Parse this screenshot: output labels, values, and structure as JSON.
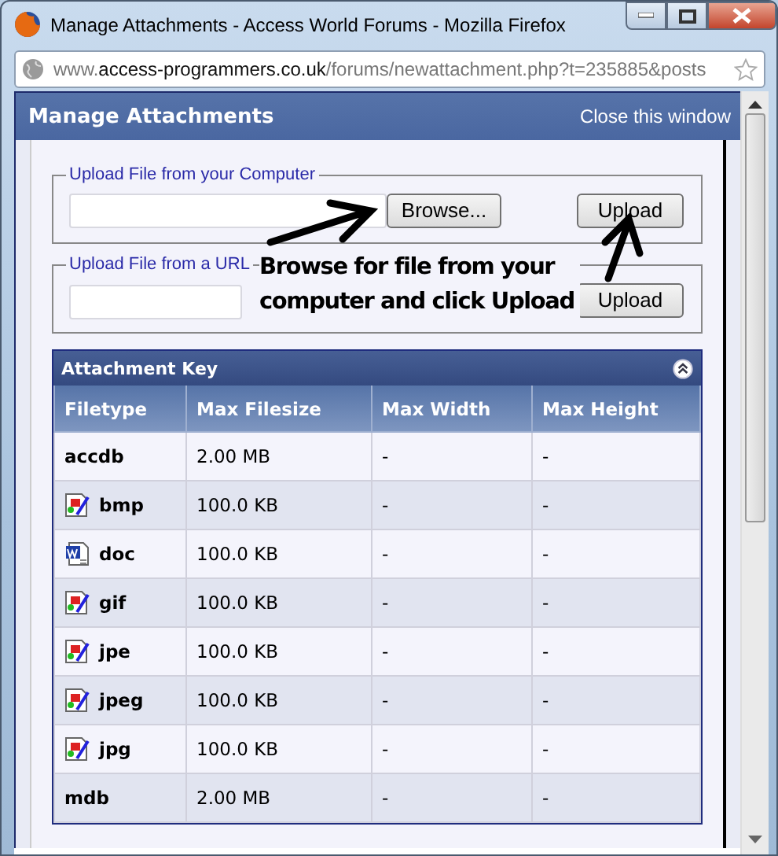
{
  "window": {
    "title": "Manage Attachments - Access World Forums - Mozilla Firefox"
  },
  "address_bar": {
    "url_prefix": "www.",
    "url_domain": "access-programmers.co.uk",
    "url_path": "/forums/newattachment.php?t=235885&posts"
  },
  "dialog": {
    "title": "Manage Attachments",
    "close_link": "Close this window"
  },
  "upload_sections": [
    {
      "kind": "file",
      "legend": "Upload File from your Computer",
      "browse_button": "Browse...",
      "upload_button": "Upload"
    },
    {
      "kind": "url",
      "legend": "Upload File from a URL",
      "upload_button": "Upload"
    }
  ],
  "annotation": {
    "text": "Browse for file from your computer and click Upload"
  },
  "attachment_key": {
    "title": "Attachment Key",
    "columns": [
      "Filetype",
      "Max Filesize",
      "Max Width",
      "Max Height"
    ],
    "rows": [
      {
        "kind": "plain",
        "filetype": "accdb",
        "max_filesize": "2.00 MB",
        "max_width": "-",
        "max_height": "-"
      },
      {
        "kind": "image",
        "filetype": "bmp",
        "max_filesize": "100.0 KB",
        "max_width": "-",
        "max_height": "-"
      },
      {
        "kind": "document",
        "filetype": "doc",
        "max_filesize": "100.0 KB",
        "max_width": "-",
        "max_height": "-"
      },
      {
        "kind": "image",
        "filetype": "gif",
        "max_filesize": "100.0 KB",
        "max_width": "-",
        "max_height": "-"
      },
      {
        "kind": "image",
        "filetype": "jpe",
        "max_filesize": "100.0 KB",
        "max_width": "-",
        "max_height": "-"
      },
      {
        "kind": "image",
        "filetype": "jpeg",
        "max_filesize": "100.0 KB",
        "max_width": "-",
        "max_height": "-"
      },
      {
        "kind": "image",
        "filetype": "jpg",
        "max_filesize": "100.0 KB",
        "max_width": "-",
        "max_height": "-"
      },
      {
        "kind": "plain",
        "filetype": "mdb",
        "max_filesize": "2.00 MB",
        "max_width": "-",
        "max_height": "-"
      }
    ]
  }
}
